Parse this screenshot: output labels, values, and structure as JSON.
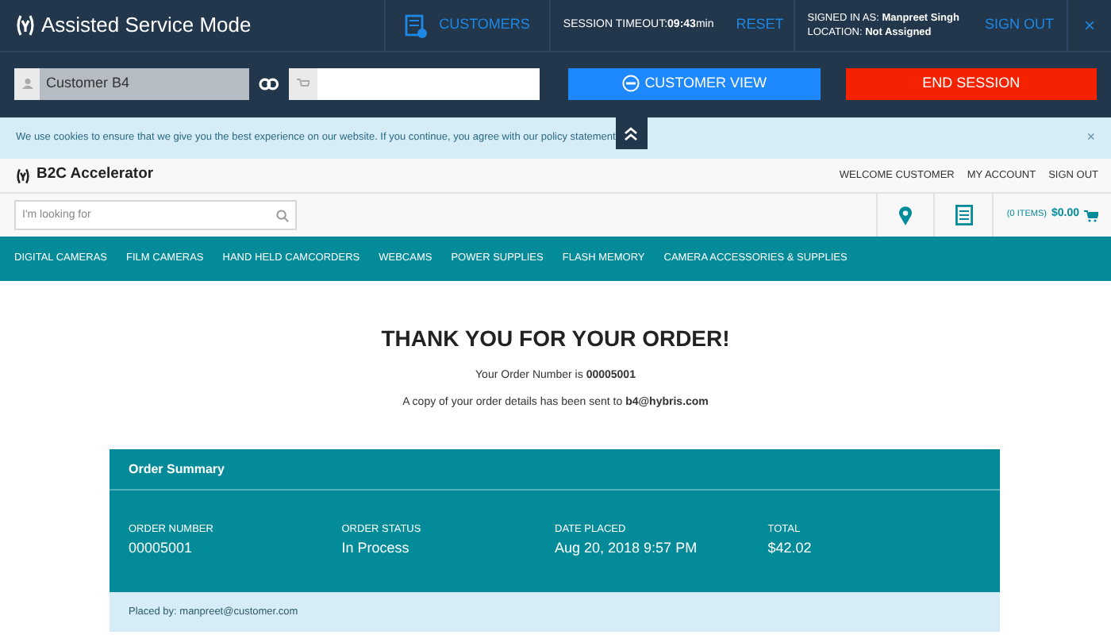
{
  "asm_bar": {
    "title": "Assisted Service Mode",
    "customers": "CUSTOMERS",
    "timeout_label": "SESSION TIMEOUT:",
    "timeout_value": "09:43",
    "timeout_unit": "min",
    "reset": "RESET",
    "signed_in_label": "SIGNED IN AS:",
    "signed_in_value": "Manpreet Singh",
    "location_label": "LOCATION:",
    "location_value": "Not Assigned",
    "sign_out": "SIGN OUT",
    "close": "×"
  },
  "session_row": {
    "customer_value": "Customer B4",
    "customer_view": "CUSTOMER VIEW",
    "end_session": "END SESSION"
  },
  "cookie_notice": {
    "text": "We use cookies to ensure that we give you the best experience on our website. If you continue, you agree with our policy statement",
    "close": "×"
  },
  "header": {
    "logo": "B2C Accelerator",
    "links": [
      "WELCOME CUSTOMER",
      "MY ACCOUNT",
      "SIGN OUT"
    ],
    "search_placeholder": "I'm looking for",
    "cart_items": "(0 ITEMS)",
    "cart_total": "$0.00"
  },
  "nav": [
    "DIGITAL CAMERAS",
    "FILM CAMERAS",
    "HAND HELD CAMCORDERS",
    "WEBCAMS",
    "POWER SUPPLIES",
    "FLASH MEMORY",
    "CAMERA ACCESSORIES & SUPPLIES"
  ],
  "confirmation": {
    "heading": "THANK YOU FOR YOUR ORDER!",
    "order_line": "Your Order Number is **00005001**",
    "email_line": "A copy of your order details has been sent to **b4@hybris.com**"
  },
  "order_summary": {
    "title": "Order Summary",
    "fields": [
      {
        "label": "ORDER NUMBER",
        "value": "00005001"
      },
      {
        "label": "ORDER STATUS",
        "value": "In Process"
      },
      {
        "label": "DATE PLACED",
        "value": "Aug 20, 2018 9:57 PM"
      },
      {
        "label": "TOTAL",
        "value": "$42.02"
      }
    ],
    "placed_by": "Placed by: manpreet@customer.com"
  }
}
